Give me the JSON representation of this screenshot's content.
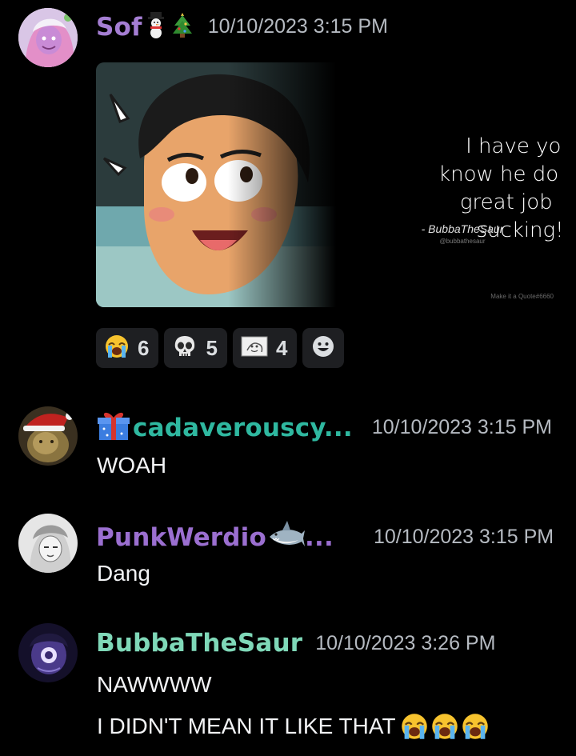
{
  "messages": [
    {
      "username": "Sof",
      "username_color": "#a57ed3",
      "decorations": [
        "snowman-icon",
        "christmas-tree-icon"
      ],
      "timestamp": "10/10/2023 3:15 PM",
      "embed": {
        "quote": "I have you know he does a great job at sucking!",
        "author": "- BubbaTheSaur",
        "handle": "@bubbathesaur",
        "watermark": "Make it a Quote#6660"
      },
      "reactions": [
        {
          "emoji": "loudly-crying-face-icon",
          "count": "6"
        },
        {
          "emoji": "skull-icon",
          "count": "5"
        },
        {
          "emoji": "custom-sketch-emoji-icon",
          "count": "4"
        }
      ]
    },
    {
      "username": "cadaverouscy...",
      "username_color": "#2fb8a0",
      "decorations": [
        "gift-icon"
      ],
      "timestamp": "10/10/2023 3:15 PM",
      "lines": [
        "WOAH"
      ]
    },
    {
      "username": "PunkWerdio",
      "username_suffix": "...",
      "username_color": "#9b6fd0",
      "decorations": [
        "shark-icon"
      ],
      "timestamp": "10/10/2023 3:15 PM",
      "lines": [
        "Dang"
      ]
    },
    {
      "username": "BubbaTheSaur",
      "username_color": "#7fd8b8",
      "timestamp": "10/10/2023 3:26 PM",
      "lines": [
        "NAWWWW",
        "I DIDN'T MEAN IT LIKE THAT"
      ]
    }
  ],
  "colors": {
    "background": "#000000",
    "reaction_bg": "#1e1f22",
    "timestamp": "#b5bac1",
    "text": "#f2f3f5"
  }
}
